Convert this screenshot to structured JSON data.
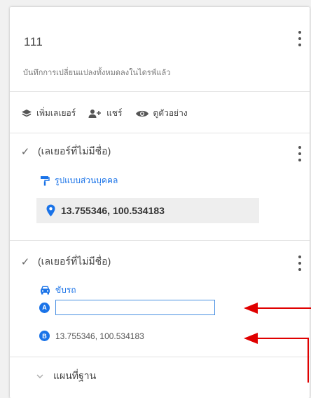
{
  "map": {
    "title": "111",
    "status": "บันทึกการเปลี่ยนแปลงทั้งหมดลงในไดรฟ์แล้ว"
  },
  "toolbar": {
    "add_layer": "เพิ่มเลเยอร์",
    "share": "แชร์",
    "preview": "ดูตัวอย่าง"
  },
  "layers": [
    {
      "checked": "✓",
      "title": "(เลเยอร์ที่ไม่มีชื่อ)",
      "style_label": "รูปแบบส่วนบุคคล",
      "place": "13.755346, 100.534183"
    },
    {
      "checked": "✓",
      "title": "(เลเยอร์ที่ไม่มีชื่อ)",
      "mode_label": "ขับรถ",
      "waypoint_a": {
        "badge": "A",
        "value": ""
      },
      "waypoint_b": {
        "badge": "B",
        "text": "13.755346, 100.534183"
      }
    }
  ],
  "basemap": {
    "label": "แผนที่ฐาน"
  },
  "colors": {
    "accent": "#1a73e8",
    "annotation_arrow": "#e00000"
  },
  "icons": [
    "more-vert-icon",
    "layers-icon",
    "person-add-icon",
    "eye-icon",
    "paint-roller-icon",
    "location-pin-icon",
    "car-icon",
    "chevron-down-icon"
  ]
}
